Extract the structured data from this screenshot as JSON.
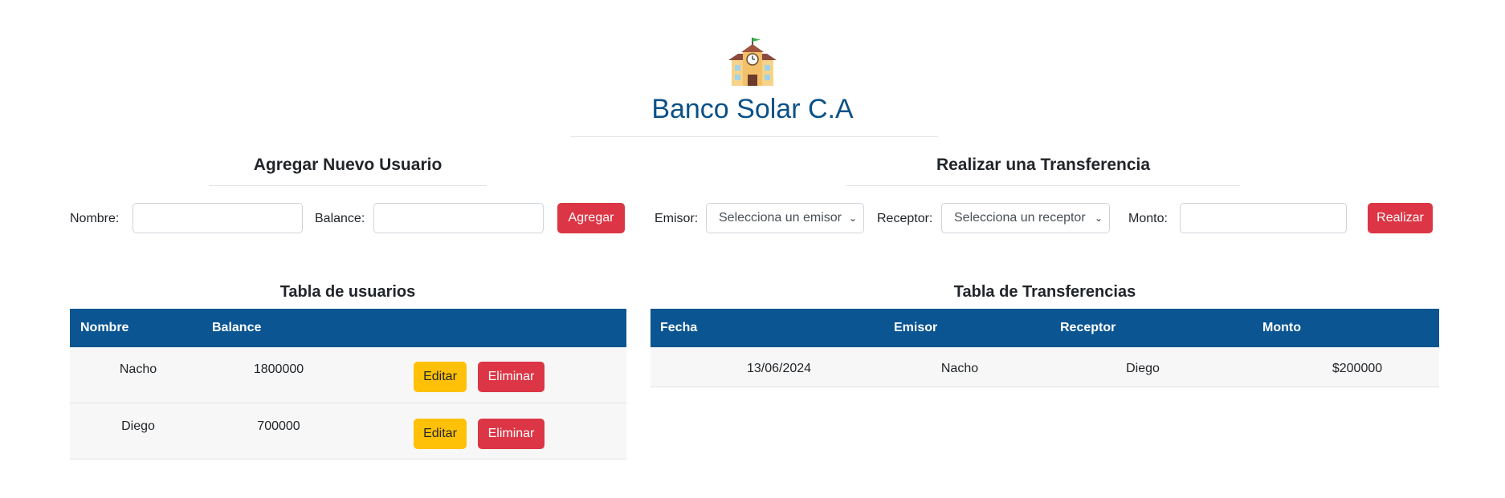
{
  "header": {
    "logo_icon": "school-building-icon",
    "title": "Banco Solar C.A"
  },
  "add_user": {
    "title": "Agregar Nuevo Usuario",
    "name_label": "Nombre:",
    "name_value": "",
    "balance_label": "Balance:",
    "balance_value": "",
    "submit_label": "Agregar"
  },
  "transfer": {
    "title": "Realizar una Transferencia",
    "sender_label": "Emisor:",
    "sender_selected": "Selecciona un emisor",
    "receiver_label": "Receptor:",
    "receiver_selected": "Selecciona un receptor",
    "amount_label": "Monto:",
    "amount_value": "",
    "submit_label": "Realizar"
  },
  "users_table": {
    "title": "Tabla de usuarios",
    "columns": [
      "Nombre",
      "Balance"
    ],
    "rows": [
      {
        "name": "Nacho",
        "balance": "1800000",
        "edit": "Editar",
        "delete": "Eliminar"
      },
      {
        "name": "Diego",
        "balance": "700000",
        "edit": "Editar",
        "delete": "Eliminar"
      }
    ]
  },
  "transfers_table": {
    "title": "Tabla de Transferencias",
    "columns": [
      "Fecha",
      "Emisor",
      "Receptor",
      "Monto"
    ],
    "rows": [
      {
        "date": "13/06/2024",
        "sender": "Nacho",
        "receiver": "Diego",
        "amount": "$200000"
      }
    ]
  },
  "colors": {
    "brand": "#0a5188",
    "table_header": "#0a5592",
    "danger": "#dc3545",
    "warning": "#ffc107"
  }
}
